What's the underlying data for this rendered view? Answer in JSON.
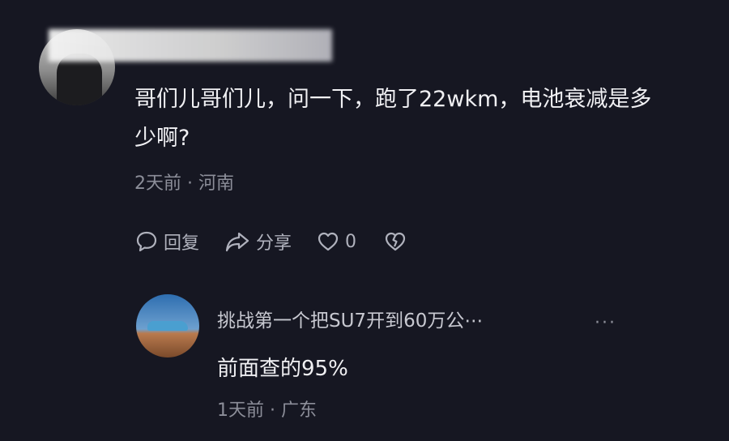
{
  "comment": {
    "text": "哥们儿哥们儿，问一下，跑了22wkm，电池衰减是多少啊?",
    "meta": "2天前 · 河南",
    "actions": {
      "reply_label": "回复",
      "share_label": "分享",
      "like_count": "0"
    }
  },
  "reply": {
    "username": "挑战第一个把SU7开到60万公⋯",
    "more_label": "···",
    "text": "前面查的95%",
    "meta": "1天前 · 广东"
  },
  "icons": {
    "reply": "comment-bubble-icon",
    "share": "share-arrow-icon",
    "like": "heart-icon",
    "dislike": "broken-heart-icon"
  },
  "colors": {
    "background": "#161722",
    "text_primary": "#f0f0f3",
    "text_secondary": "#8c8e99"
  }
}
